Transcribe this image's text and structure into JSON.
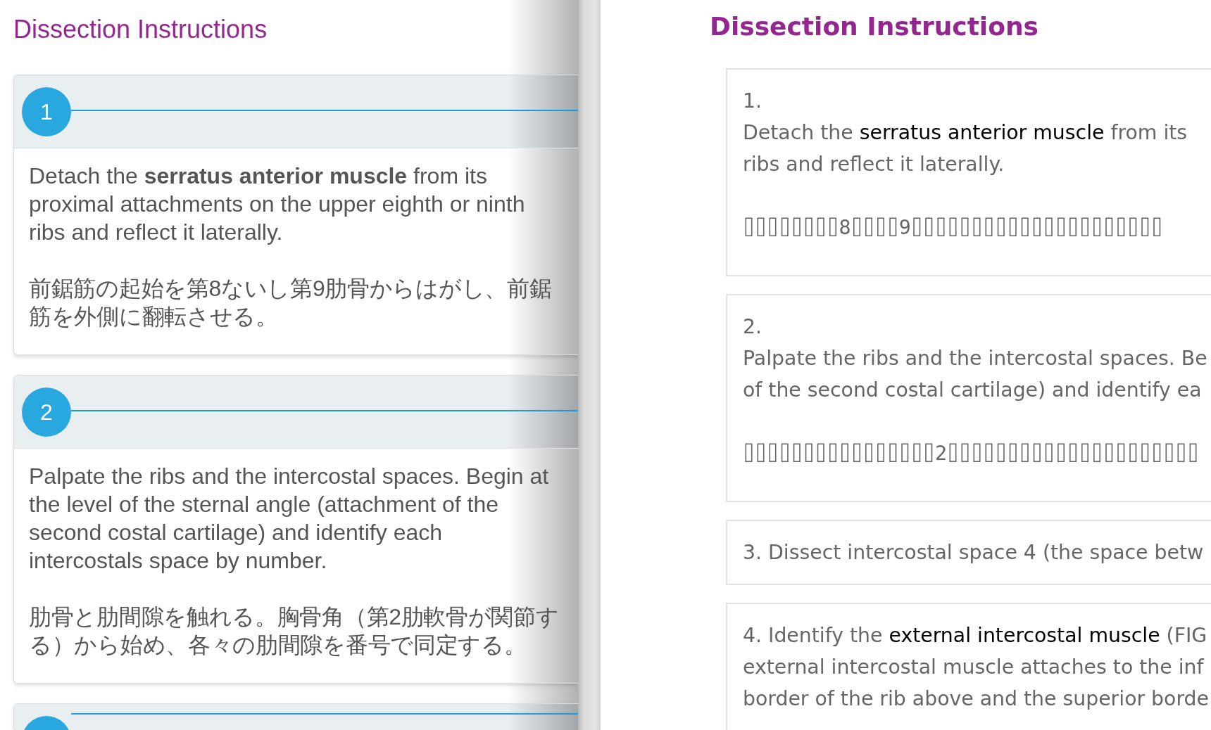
{
  "left_panel": {
    "title": "Dissection Instructions",
    "steps": [
      {
        "number": "1",
        "paragraphs": [
          {
            "kind": "english",
            "text": "Detach the **serratus anterior muscle** from its proximal attachments on the upper eighth or ninth ribs and reflect it laterally."
          },
          {
            "kind": "japanese",
            "text": "前鋸筋の起始を第8ないし第9肋骨からはがし、前鋸筋を外側に翻転させる。"
          }
        ]
      },
      {
        "number": "2",
        "paragraphs": [
          {
            "kind": "english",
            "text": "Palpate the ribs and the intercostal spaces. Begin at the level of the sternal angle (attachment of the second costal cartilage) and identify each intercostals space by number."
          },
          {
            "kind": "japanese",
            "text": "肋骨と肋間隙を触れる。胸骨角（第2肋軟骨が関節する）から始め、各々の肋間隙を番号で同定する。"
          }
        ]
      }
    ],
    "next_step_cut_off": true
  },
  "right_panel": {
    "title": "Dissection Instructions",
    "steps": [
      {
        "number": "1.",
        "paragraphs": [
          {
            "kind": "text",
            "lines": [
              "Detach the **serratus anterior muscle** from its",
              "ribs and reflect it laterally."
            ]
          },
          {
            "kind": "tofu",
            "lines": [
              "⌷⌷⌷⌷⌷⌷⌷⌷8⌷⌷⌷⌷9⌷⌷⌷⌷⌷⌷⌷⌷⌷⌷⌷⌷⌷⌷⌷⌷⌷⌷⌷⌷⌷"
            ]
          }
        ]
      },
      {
        "number": "2.",
        "paragraphs": [
          {
            "kind": "text",
            "lines": [
              "Palpate the ribs and the intercostal spaces. Be",
              "of the second costal cartilage) and identify ea"
            ]
          },
          {
            "kind": "tofu",
            "lines": [
              "⌷⌷⌷⌷⌷⌷⌷⌷⌷⌷⌷⌷⌷⌷⌷⌷2⌷⌷⌷⌷⌷⌷⌷⌷⌷⌷⌷⌷⌷⌷⌷⌷⌷⌷⌷⌷⌷"
            ]
          }
        ]
      },
      {
        "paragraphs": [
          {
            "kind": "text",
            "lines": [
              "3. Dissect intercostal space 4 (the space betw"
            ]
          }
        ]
      },
      {
        "paragraphs": [
          {
            "kind": "text",
            "lines": [
              "4. Identify the **external intercostal muscle** (FIG",
              "external intercostal muscle attaches to the inf",
              "border of the rib above and the superior borde"
            ]
          }
        ]
      }
    ]
  }
}
